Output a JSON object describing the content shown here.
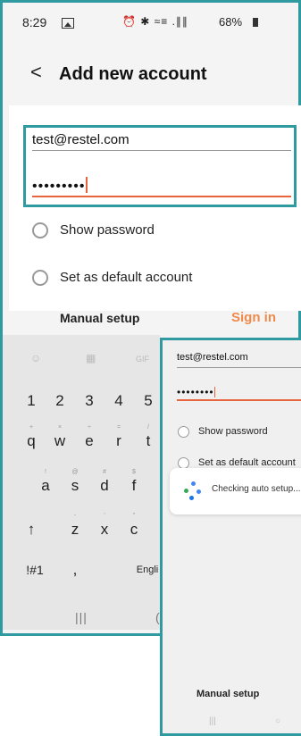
{
  "status_bar": {
    "time": "8:29",
    "icons_text": "⏰ ✱ ≈≡ .∥∥",
    "battery": "68%"
  },
  "header": {
    "back_glyph": "<",
    "title": "Add new account"
  },
  "form": {
    "email": "test@restel.com",
    "password_mask": "•••••••••",
    "show_password": "Show password",
    "default_account": "Set as default account"
  },
  "actions": {
    "manual_setup": "Manual setup",
    "sign_in": "Sign in"
  },
  "keyboard": {
    "tools": [
      "☺",
      "▦",
      "GIF"
    ],
    "row_numbers": [
      "1",
      "2",
      "3",
      "4",
      "5"
    ],
    "row_q": [
      {
        "key": "q",
        "sup": "+"
      },
      {
        "key": "w",
        "sup": "×"
      },
      {
        "key": "e",
        "sup": "÷"
      },
      {
        "key": "r",
        "sup": "="
      },
      {
        "key": "t",
        "sup": "/"
      }
    ],
    "row_a": [
      {
        "key": "a",
        "sup": "!"
      },
      {
        "key": "s",
        "sup": "@"
      },
      {
        "key": "d",
        "sup": "#"
      },
      {
        "key": "f",
        "sup": "$"
      }
    ],
    "row_z": [
      {
        "key": "↑",
        "sup": ""
      },
      {
        "key": "z",
        "sup": "-"
      },
      {
        "key": "x",
        "sup": "'"
      },
      {
        "key": "c",
        "sup": "\""
      }
    ],
    "symbols_key": "!#1",
    "comma_key": ",",
    "space_key": "Engli",
    "nav_back": "|||",
    "nav_home": "("
  },
  "overlay": {
    "email": "test@restel.com",
    "password_mask": "••••••••",
    "show_password": "Show password",
    "default_account": "Set as default account",
    "checking": "Checking auto setup...",
    "manual_setup": "Manual setup",
    "nav_recent": "|||",
    "nav_home": "○"
  },
  "colors": {
    "accent_teal": "#2f9aa0",
    "sign_in_orange": "#f08a4b",
    "caret_orange": "#e8643c"
  }
}
